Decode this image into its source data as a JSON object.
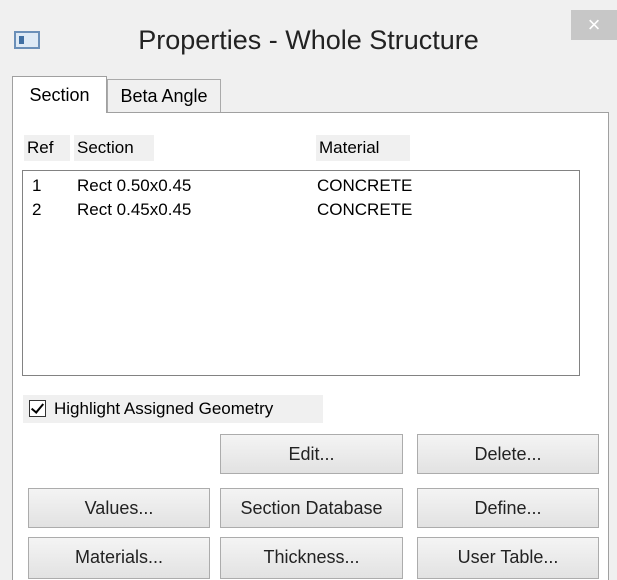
{
  "window": {
    "title": "Properties - Whole Structure",
    "close_glyph": "×",
    "app_icon": "properties-window-icon",
    "close_icon": "close-x-icon"
  },
  "tabs": [
    {
      "label": "Section",
      "selected": true
    },
    {
      "label": "Beta Angle",
      "selected": false
    }
  ],
  "table": {
    "columns": [
      "Ref",
      "Section",
      "Material"
    ],
    "rows": [
      {
        "ref": "1",
        "section": "Rect 0.50x0.45",
        "material": "CONCRETE"
      },
      {
        "ref": "2",
        "section": "Rect 0.45x0.45",
        "material": "CONCRETE"
      }
    ]
  },
  "highlight": {
    "label": "Highlight Assigned Geometry",
    "checked": true
  },
  "buttons": {
    "edit": "Edit...",
    "delete": "Delete...",
    "values": "Values...",
    "section_database": "Section Database",
    "define": "Define...",
    "materials": "Materials...",
    "thickness": "Thickness...",
    "user_table": "User Table..."
  },
  "colors": {
    "window_bg": "#f0f0f0",
    "panel_bg": "#ffffff",
    "close_bg": "#c7c7c7"
  }
}
